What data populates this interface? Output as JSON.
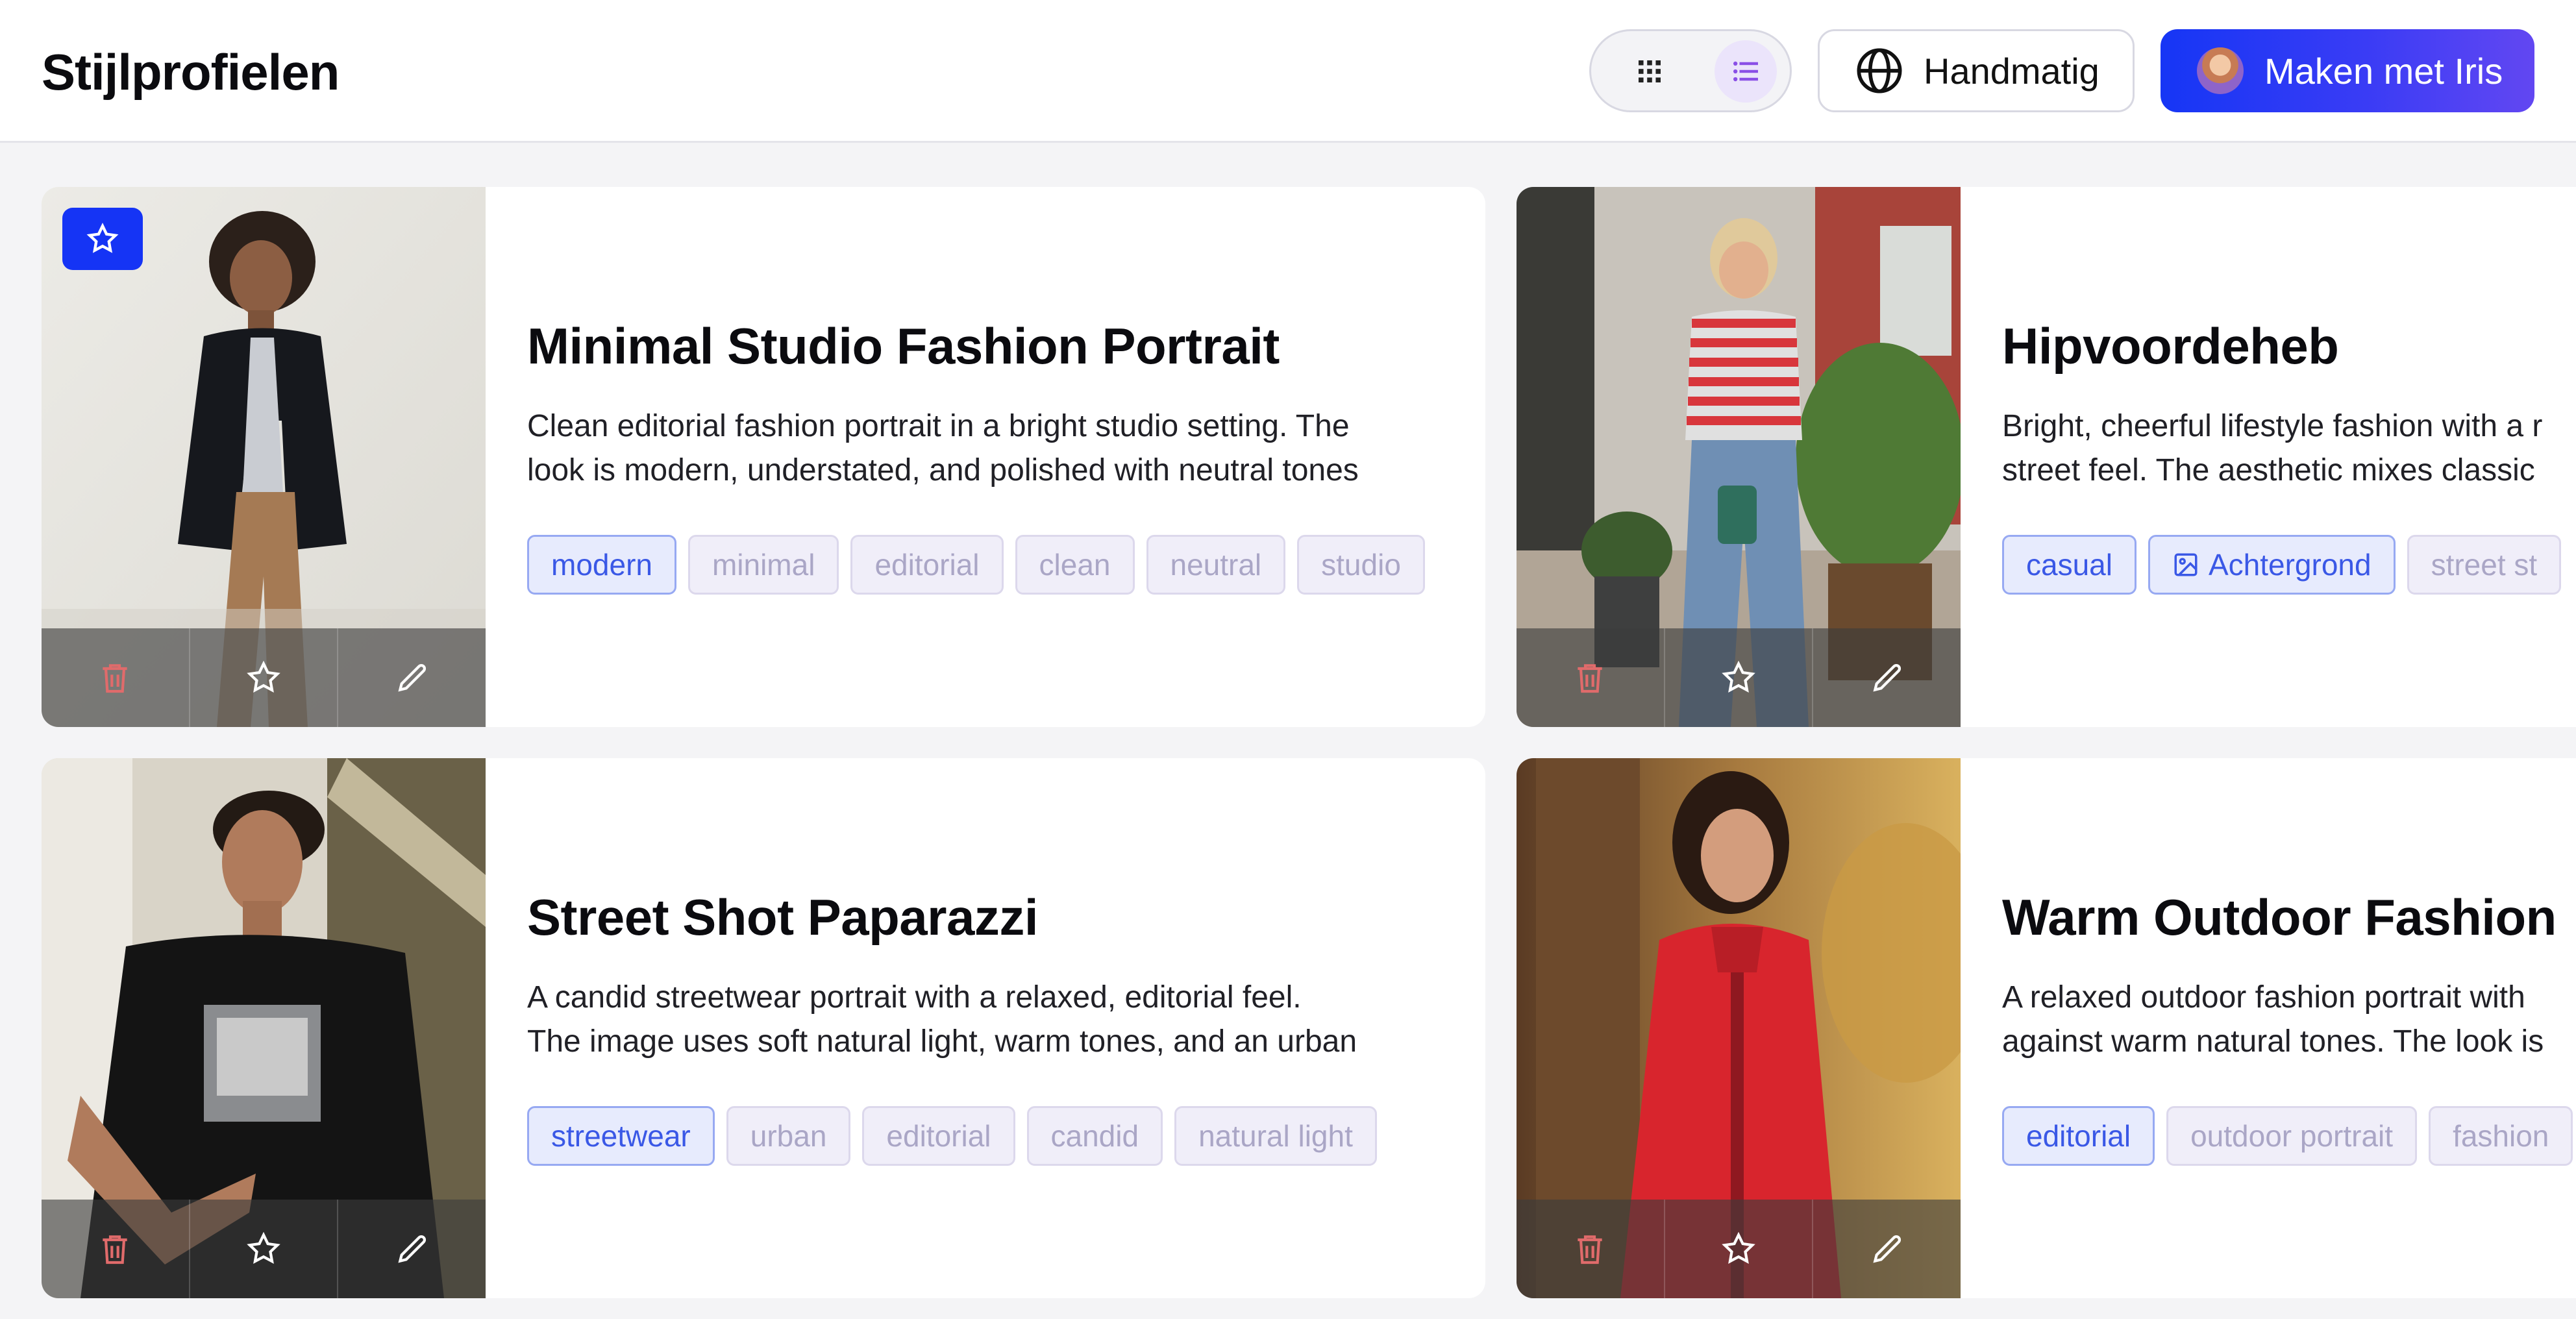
{
  "header": {
    "title": "Stijlprofielen",
    "manual_label": "Handmatig",
    "iris_label": "Maken met Iris"
  },
  "colors": {
    "accent": "#1534f5",
    "tag_primary_text": "#3a58e6",
    "tag_text": "#aaa6c6",
    "delete_icon": "#e06b6b"
  },
  "cards": [
    {
      "title": "Minimal Studio Fashion Portrait",
      "desc_line1": "Clean editorial fashion portrait in a bright studio setting. The",
      "desc_line2": "look is modern, understated, and polished with neutral tones",
      "favorite": true,
      "tags": [
        "modern",
        "minimal",
        "editorial",
        "clean",
        "neutral",
        "studio"
      ]
    },
    {
      "title": "Hipvoordeheb",
      "desc_line1": "Bright, cheerful lifestyle fashion with a r",
      "desc_line2": "street feel. The aesthetic mixes classic",
      "favorite": false,
      "tags": [
        "casual",
        "Achtergrond",
        "street st"
      ]
    },
    {
      "title": "Street Shot Paparazzi",
      "desc_line1": "A candid streetwear portrait with a relaxed, editorial feel.",
      "desc_line2": "The image uses soft natural light, warm tones, and an urban",
      "favorite": false,
      "tags": [
        "streetwear",
        "urban",
        "editorial",
        "candid",
        "natural light"
      ]
    },
    {
      "title": "Warm Outdoor Fashion",
      "desc_line1": "A relaxed outdoor fashion portrait with",
      "desc_line2": "against warm natural tones. The look is",
      "favorite": false,
      "tags": [
        "editorial",
        "outdoor portrait",
        "fashion"
      ]
    }
  ]
}
